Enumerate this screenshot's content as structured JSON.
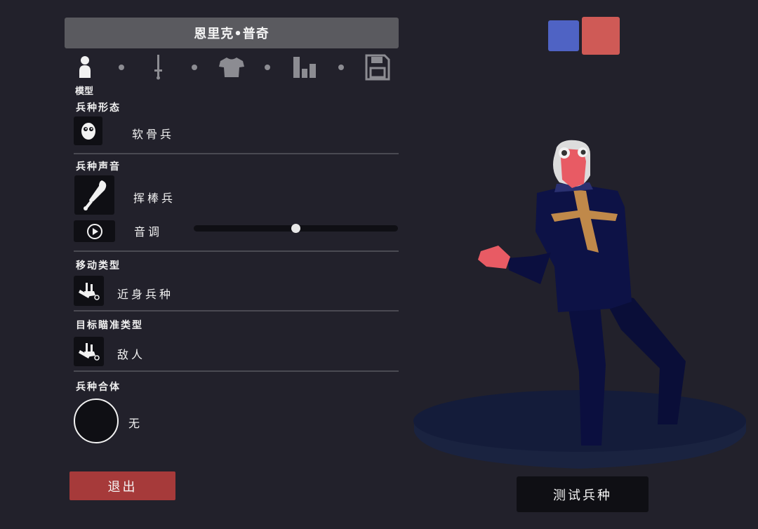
{
  "unit_name": "恩里克•普奇",
  "tabs": {
    "active_label": "模型",
    "icons": [
      "person-icon",
      "sword-icon",
      "shirt-icon",
      "bar-chart-icon",
      "save-disk-icon"
    ]
  },
  "sections": {
    "form": {
      "title": "兵种形态",
      "value": "软骨兵"
    },
    "voice": {
      "title": "兵种声音",
      "value": "挥棒兵",
      "pitch_label": "音调",
      "pitch_level": 0.5
    },
    "movement": {
      "title": "移动类型",
      "value": "近身兵种"
    },
    "targeting": {
      "title": "目标瞄准类型",
      "value": "敌人"
    },
    "combine": {
      "title": "兵种合体",
      "value": "无"
    }
  },
  "buttons": {
    "exit": "退出",
    "test": "测试兵种"
  },
  "colors": {
    "team_blue": "#4f63c4",
    "team_red": "#cf5a56",
    "exit": "#a63a3a",
    "body": "#0b0f3f",
    "skin": "#e85b64",
    "cross": "#c0894a"
  }
}
